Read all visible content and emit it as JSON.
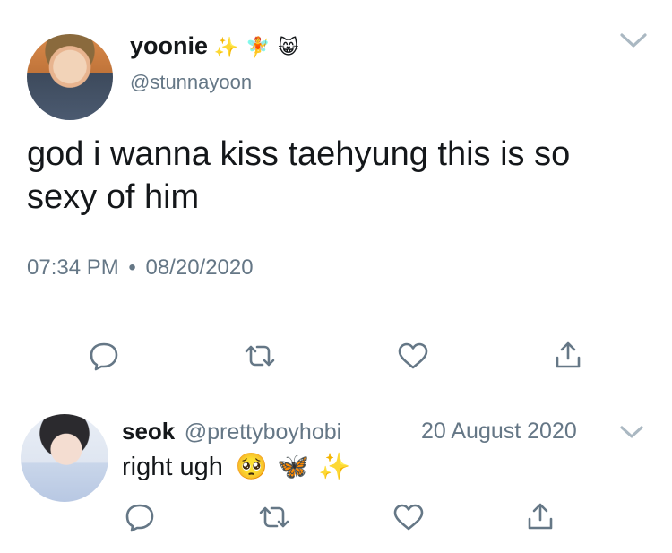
{
  "tweet": {
    "display_name": "yoonie",
    "name_emojis": [
      "✨",
      "🧚",
      "😸"
    ],
    "handle": "@stunnayoon",
    "text": "god i wanna kiss taehyung this is so sexy of him",
    "time": "07:34 PM",
    "separator": "•",
    "date": "08/20/2020"
  },
  "reply": {
    "display_name": "seok",
    "handle": "@prettyboyhobi",
    "date": "20 August 2020",
    "text": "right ugh",
    "text_emojis": [
      "🥺",
      "🦋",
      "✨"
    ]
  },
  "actions": [
    "reply-icon",
    "retweet-icon",
    "like-icon",
    "share-icon"
  ],
  "colors": {
    "text": "#14171a",
    "secondary": "#657786",
    "divider": "#e1e8ed",
    "chevron": "#aab8c2"
  }
}
